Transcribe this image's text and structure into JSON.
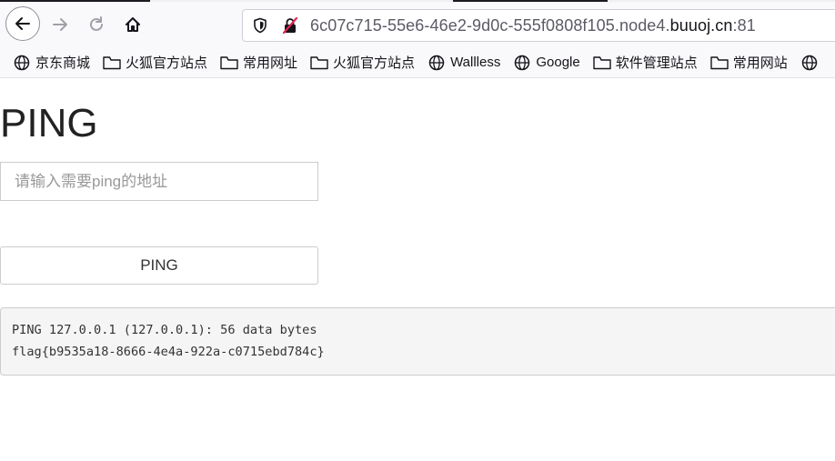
{
  "browser": {
    "url_prefix": "6c07c715-55e6-46e2-9d0c-555f0808f105.node4.",
    "url_domain": "buuoj.cn",
    "url_suffix": ":81"
  },
  "bookmarks": [
    {
      "label": "京东商城",
      "icon": "globe-icon"
    },
    {
      "label": "火狐官方站点",
      "icon": "folder-icon"
    },
    {
      "label": "常用网址",
      "icon": "folder-icon"
    },
    {
      "label": "火狐官方站点",
      "icon": "folder-icon"
    },
    {
      "label": "Wallless",
      "icon": "globe-icon"
    },
    {
      "label": "Google",
      "icon": "globe-icon"
    },
    {
      "label": "软件管理站点",
      "icon": "folder-icon"
    },
    {
      "label": "常用网站",
      "icon": "folder-icon"
    }
  ],
  "page": {
    "title": "PING",
    "input_placeholder": "请输入需要ping的地址",
    "input_value": "",
    "button_label": "PING",
    "output": {
      "line1": "PING 127.0.0.1 (127.0.0.1): 56 data bytes",
      "line2": "flag{b9535a18-8666-4e4a-922a-c0715ebd784c}"
    }
  },
  "colors": {
    "toolbar_bg": "#f9f9fb",
    "output_bg": "#f5f5f5",
    "border": "#cccccc"
  }
}
